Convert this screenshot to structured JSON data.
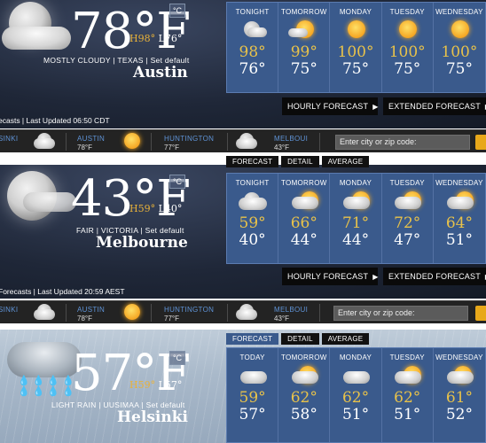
{
  "colors": {
    "hi_temp": "#e8b23a",
    "forecast_panel": "#3a5a8c",
    "ticker_city": "#5f93d6",
    "go_button": "#e8a81a"
  },
  "panels": [
    {
      "temp": "78°F",
      "unit": "°C",
      "hi": "H98°",
      "lo": "L76°",
      "condition": "MOSTLY CLOUDY | TEXAS | Set default",
      "city": "Austin",
      "updated": "ecasts | Last Updated 06:50 CDT",
      "forecast": [
        {
          "day": "TONIGHT",
          "hi": "98°",
          "lo": "76°",
          "icon": "moon-cloud-icon"
        },
        {
          "day": "TOMORROW",
          "hi": "99°",
          "lo": "75°",
          "icon": "sun-cloud-icon"
        },
        {
          "day": "MONDAY",
          "hi": "100°",
          "lo": "75°",
          "icon": "sun-icon"
        },
        {
          "day": "TUESDAY",
          "hi": "100°",
          "lo": "75°",
          "icon": "sun-icon"
        },
        {
          "day": "WEDNESDAY",
          "hi": "100°",
          "lo": "75°",
          "icon": "sun-icon"
        }
      ],
      "hourly_label": "HOURLY FORECAST",
      "extended_label": "EXTENDED FORECAST"
    },
    {
      "temp": "43°F",
      "unit": "°C",
      "hi": "H59°",
      "lo": "L40°",
      "condition": "FAIR | VICTORIA | Set default",
      "city": "Melbourne",
      "updated": "Forecasts | Last Updated 20:59 AEST",
      "forecast": [
        {
          "day": "TONIGHT",
          "hi": "59°",
          "lo": "40°",
          "icon": "moon-cloud-icon"
        },
        {
          "day": "TOMORROW",
          "hi": "66°",
          "lo": "44°",
          "icon": "sun-cloud-icon"
        },
        {
          "day": "MONDAY",
          "hi": "71°",
          "lo": "44°",
          "icon": "sun-cloud-icon"
        },
        {
          "day": "TUESDAY",
          "hi": "72°",
          "lo": "47°",
          "icon": "sun-cloud-icon"
        },
        {
          "day": "WEDNESDAY",
          "hi": "64°",
          "lo": "51°",
          "icon": "sun-cloud-icon"
        }
      ],
      "hourly_label": "HOURLY FORECAST",
      "extended_label": "EXTENDED FORECAST"
    },
    {
      "temp": "57°F",
      "unit": "°C",
      "hi": "H59°",
      "lo": "L57°",
      "condition": "LIGHT RAIN | UUSIMAA | Set default",
      "city": "Helsinki",
      "forecast": [
        {
          "day": "TODAY",
          "hi": "59°",
          "lo": "57°",
          "icon": "rain-cloud-icon"
        },
        {
          "day": "TOMORROW",
          "hi": "62°",
          "lo": "58°",
          "icon": "sun-rain-icon"
        },
        {
          "day": "MONDAY",
          "hi": "62°",
          "lo": "51°",
          "icon": "rain-cloud-icon"
        },
        {
          "day": "TUESDAY",
          "hi": "62°",
          "lo": "51°",
          "icon": "sun-cloud-icon"
        },
        {
          "day": "WEDNESDAY",
          "hi": "61°",
          "lo": "52°",
          "icon": "sun-rain-icon"
        }
      ]
    }
  ],
  "tabs": [
    "FORECAST",
    "DETAIL",
    "AVERAGE"
  ],
  "ticker": {
    "items": [
      {
        "city": "SINKI",
        "temp": ""
      },
      {
        "city": "AUSTIN",
        "temp": "78°F"
      },
      {
        "city": "HUNTINGTON",
        "temp": "77°F"
      },
      {
        "city": "MELBOUI",
        "temp": "43°F"
      }
    ],
    "search_placeholder": "Enter city or zip code:"
  }
}
